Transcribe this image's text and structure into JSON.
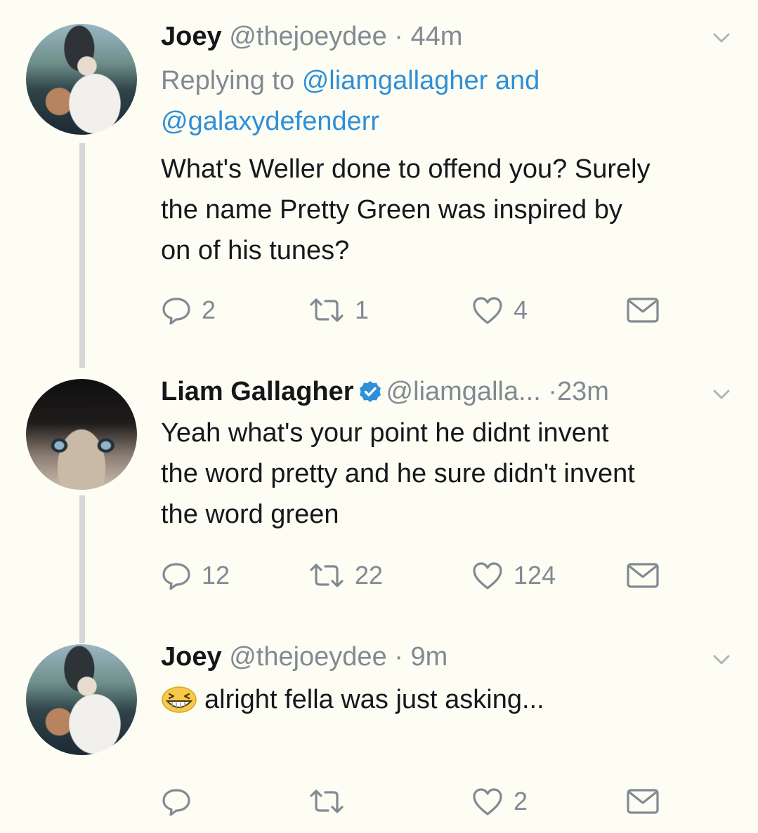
{
  "tweets": [
    {
      "name": "Joey",
      "handle": "@thejoeydee",
      "dot": "·",
      "time": "44m",
      "replying_prefix": "Replying to",
      "reply_link_1": "@liamgallagher",
      "reply_and": "and",
      "reply_link_2": "@galaxydefenderr",
      "text_lines": [
        "What's Weller done to offend you? Surely",
        "the name Pretty Green was inspired by",
        "on of his tunes?"
      ],
      "replies": "2",
      "retweets": "1",
      "likes": "4"
    },
    {
      "name": "Liam Gallagher",
      "verified": true,
      "handle": "@liamgalla...",
      "dot": "·",
      "time": "23m",
      "text_lines": [
        "Yeah what's your point he didnt invent",
        "the word pretty and he sure didn't invent",
        "the word green"
      ],
      "replies": "12",
      "retweets": "22",
      "likes": "124"
    },
    {
      "name": "Joey",
      "handle": "@thejoeydee",
      "dot": "·",
      "time": "9m",
      "emoji": "grinning-squinting-face-emoji",
      "text": "alright fella was just asking...",
      "replies": "",
      "retweets": "",
      "likes": "2"
    }
  ],
  "icons": {
    "reply": "reply-bubble-icon",
    "retweet": "retweet-icon",
    "like": "heart-icon",
    "dm": "envelope-icon",
    "menu": "chevron-down-icon",
    "verified": "verified-badge-icon"
  },
  "colors": {
    "background": "#fdfdf4",
    "text": "#17181c",
    "muted": "#818a93",
    "link": "#2f8fd8",
    "verified": "#2f8fd8",
    "thread_line": "#d4d6d7"
  }
}
